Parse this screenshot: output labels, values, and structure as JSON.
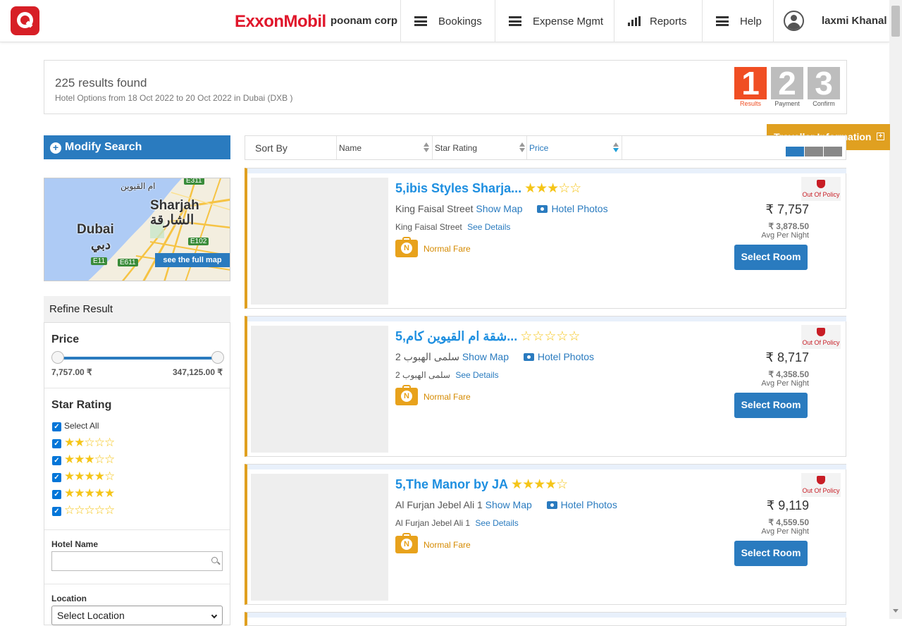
{
  "header": {
    "brand_exxon": "ExxonMobil",
    "company": "poonam corp",
    "nav": [
      {
        "label": "Bookings",
        "icon": "menu-icon"
      },
      {
        "label": "Expense Mgmt",
        "icon": "menu-icon"
      },
      {
        "label": "Reports",
        "icon": "bar-chart-icon"
      },
      {
        "label": "Help",
        "icon": "menu-icon"
      }
    ],
    "user": "laxmi Khanal"
  },
  "summary": {
    "count": "225 results found",
    "sub": "Hotel Options from  18 Oct 2022 to 20 Oct 2022 in Dubai (DXB )",
    "steps": [
      {
        "num": "1",
        "label": "Results",
        "active": true
      },
      {
        "num": "2",
        "label": "Payment",
        "active": false
      },
      {
        "num": "3",
        "label": "Confirm",
        "active": false
      }
    ]
  },
  "traveller_tab": "Traveller Information",
  "sidebar": {
    "modify": "Modify Search",
    "map": {
      "cities": [
        "Sharjah",
        "الشارقة",
        "Dubai",
        "دبي",
        "ام القيوين"
      ],
      "roads": [
        "E311",
        "E102",
        "E11",
        "E611"
      ],
      "full_map": "see the full map"
    },
    "refine_title": "Refine Result",
    "price": {
      "title": "Price",
      "min": "7,757.00 ₹",
      "max": "347,125.00 ₹"
    },
    "star_rating": {
      "title": "Star Rating",
      "select_all": "Select All",
      "options": [
        {
          "filled": "★★",
          "empty": "☆☆☆"
        },
        {
          "filled": "★★★",
          "empty": "☆☆"
        },
        {
          "filled": "★★★★",
          "empty": "☆"
        },
        {
          "filled": "★★★★★",
          "empty": ""
        },
        {
          "filled": "",
          "empty": "☆☆☆☆☆"
        }
      ]
    },
    "hotel_name": {
      "label": "Hotel Name",
      "placeholder": ""
    },
    "location": {
      "label": "Location",
      "value": "Select Location"
    }
  },
  "sortbar": {
    "sort_by": "Sort By",
    "columns": [
      "Name",
      "Star Rating",
      "Price"
    ]
  },
  "hotels": [
    {
      "title": "5,ibis Styles Sharja...",
      "stars_filled": "★★★",
      "stars_empty": "☆☆",
      "street": "King Faisal Street",
      "show_map": "Show Map",
      "photos": "Hotel Photos",
      "street2": "King Faisal Street",
      "see_details": "See Details",
      "fare": "Normal Fare",
      "fare_badge": "N",
      "policy": "Out Of Policy",
      "price": "₹ 7,757",
      "avg_price": "₹ 3,878.50",
      "avg_label": "Avg Per Night",
      "select": "Select Room"
    },
    {
      "title": "5,شقة ام القيوين كام...",
      "stars_filled": "",
      "stars_empty": "☆☆☆☆☆",
      "street": "2 سلمى الهبوب",
      "show_map": "Show Map",
      "photos": "Hotel Photos",
      "street2": "2 سلمى الهبوب",
      "see_details": "See Details",
      "fare": "Normal Fare",
      "fare_badge": "N",
      "policy": "Out Of Policy",
      "price": "₹ 8,717",
      "avg_price": "₹ 4,358.50",
      "avg_label": "Avg Per Night",
      "select": "Select Room"
    },
    {
      "title": "5,The Manor by JA",
      "stars_filled": "★★★★",
      "stars_empty": "☆",
      "street": "Al Furjan Jebel Ali 1",
      "show_map": "Show Map",
      "photos": "Hotel Photos",
      "street2": "Al Furjan Jebel Ali 1",
      "see_details": "See Details",
      "fare": "Normal Fare",
      "fare_badge": "N",
      "policy": "Out Of Policy",
      "price": "₹ 9,119",
      "avg_price": "₹ 4,559.50",
      "avg_label": "Avg Per Night",
      "select": "Select Room"
    }
  ],
  "colors": {
    "brand_red": "#e0162b",
    "primary_blue": "#2a7bbf",
    "link_blue": "#1e8fe0",
    "fare_orange": "#e0a020",
    "policy_red": "#c81d25",
    "step_active": "#f04e23",
    "step_inactive": "#bdbdbd"
  }
}
